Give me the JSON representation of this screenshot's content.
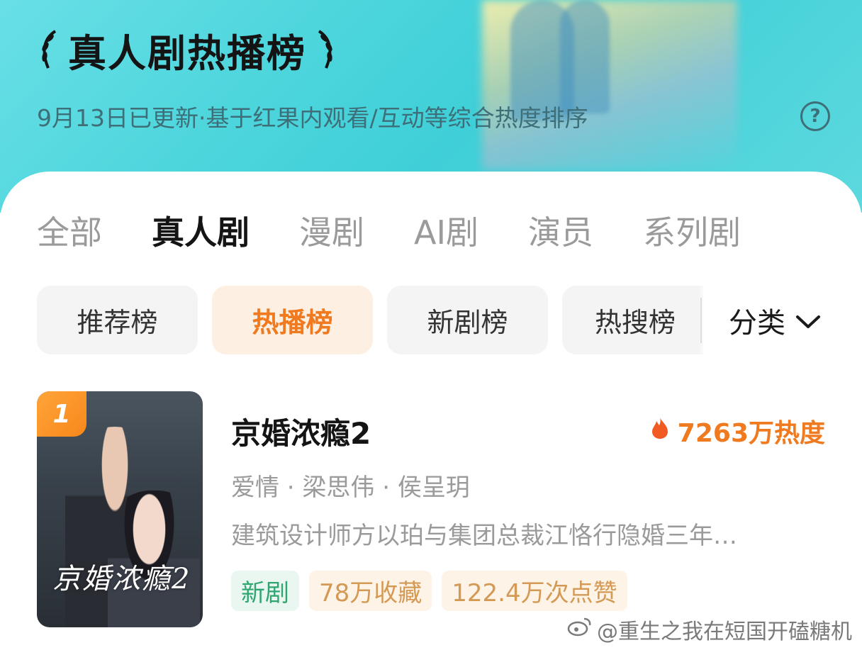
{
  "header": {
    "title": "真人剧热播榜",
    "subtitle": "9月13日已更新·基于红果内观看/互动等综合热度排序",
    "help_icon": "question-circle-icon"
  },
  "tabs": [
    {
      "label": "全部",
      "active": false
    },
    {
      "label": "真人剧",
      "active": true
    },
    {
      "label": "漫剧",
      "active": false
    },
    {
      "label": "AI剧",
      "active": false
    },
    {
      "label": "演员",
      "active": false
    },
    {
      "label": "系列剧",
      "active": false
    }
  ],
  "filters": [
    {
      "label": "推荐榜",
      "active": false
    },
    {
      "label": "热播榜",
      "active": true
    },
    {
      "label": "新剧榜",
      "active": false
    },
    {
      "label": "热搜榜",
      "active": false
    }
  ],
  "category": {
    "label": "分类",
    "icon": "chevron-down-icon"
  },
  "ranking": [
    {
      "rank": "1",
      "title": "京婚浓瘾2",
      "heat": "7263万热度",
      "meta": "爱情 · 梁思伟 · 侯呈玥",
      "description": "建筑设计师方以珀与集团总裁江恪行隐婚三年…",
      "poster_text": "京婚浓瘾2",
      "tags": [
        {
          "label": "新剧",
          "style": "green"
        },
        {
          "label": "78万收藏",
          "style": "orange"
        },
        {
          "label": "122.4万次点赞",
          "style": "orange"
        }
      ]
    }
  ],
  "watermark": "@重生之我在短国开磕糖机",
  "colors": {
    "accent": "#f07a1f",
    "header_bg": "#4fd6dd",
    "tag_green": "#2fa56f",
    "tag_orange": "#d49a55"
  }
}
